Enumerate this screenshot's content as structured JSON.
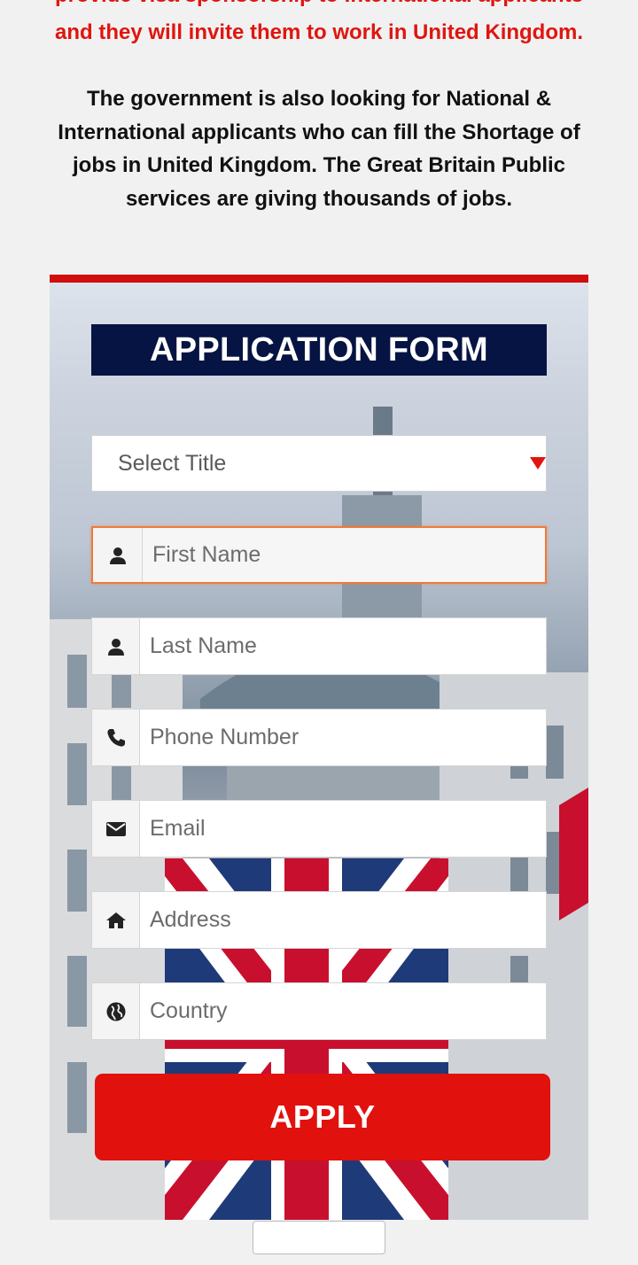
{
  "intro": {
    "red_cut_line": "provide visa sponsorship to International applicants",
    "red_line": "and they will invite them to work in United Kingdom.",
    "paragraph": "The government is also looking for National & International applicants who can fill the Shortage of jobs in United Kingdom. The Great Britain Public services are giving thousands of jobs."
  },
  "form": {
    "title": "APPLICATION FORM",
    "select_title": {
      "value": "Select Title",
      "arrow_icon": "triangle-down-icon"
    },
    "fields": [
      {
        "placeholder": "First Name",
        "icon": "user-icon",
        "focused": true
      },
      {
        "placeholder": "Last Name",
        "icon": "user-icon"
      },
      {
        "placeholder": "Phone Number",
        "icon": "phone-icon"
      },
      {
        "placeholder": "Email",
        "icon": "envelope-icon"
      },
      {
        "placeholder": "Address",
        "icon": "home-icon"
      },
      {
        "placeholder": "Country",
        "icon": "globe-icon"
      }
    ],
    "apply_label": "APPLY"
  },
  "colors": {
    "accent_red": "#e1110e",
    "title_navy": "#061443",
    "focus_orange": "#f07a3a"
  }
}
